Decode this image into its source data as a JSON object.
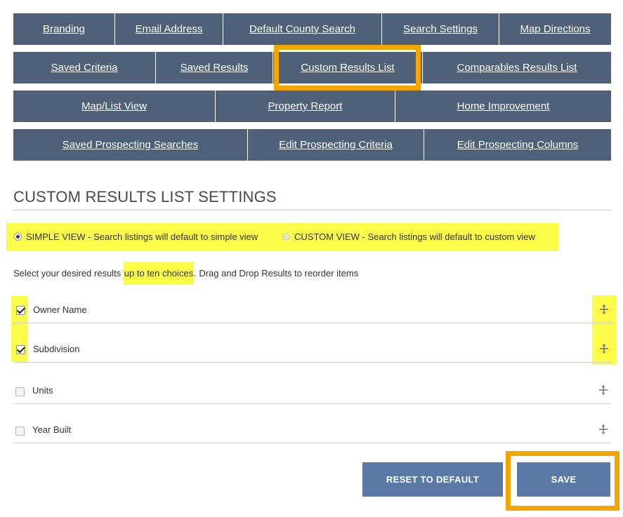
{
  "nav": {
    "row1": [
      "Branding",
      "Email Address",
      "Default County Search",
      "Search Settings",
      "Map Directions"
    ],
    "row2": [
      "Saved Criteria",
      "Saved Results",
      "Custom Results List",
      "Comparables Results List"
    ],
    "row3": [
      "Map/List View",
      "Property Report",
      "Home Improvement"
    ],
    "row4": [
      "Saved Prospecting Searches",
      "Edit Prospecting Criteria",
      "Edit Prospecting Columns"
    ],
    "active_tab": "Custom Results List"
  },
  "section": {
    "title": "CUSTOM RESULTS LIST SETTINGS"
  },
  "view_options": {
    "simple": {
      "label": "SIMPLE VIEW - Search listings will default to simple view",
      "selected": true
    },
    "custom": {
      "label": "CUSTOM VIEW - Search listings will default to custom view",
      "selected": false
    }
  },
  "instructions": {
    "before": "Select your desired results ",
    "highlight": "up to ten choices",
    "after": ". Drag and Drop Results to reorder items"
  },
  "results_items": [
    {
      "label": "Owner Name",
      "checked": true
    },
    {
      "label": "Subdivision",
      "checked": true
    },
    {
      "label": "Units",
      "checked": false
    },
    {
      "label": "Year Built",
      "checked": false
    }
  ],
  "buttons": {
    "reset": "RESET TO DEFAULT",
    "save": "SAVE"
  },
  "colors": {
    "nav_bg": "#4f6179",
    "highlight_yellow": "#fbfb4a",
    "annotation_orange": "#f5a400",
    "button_blue": "#5b79a6"
  },
  "icons": {
    "drag_handle": "move-icon"
  }
}
